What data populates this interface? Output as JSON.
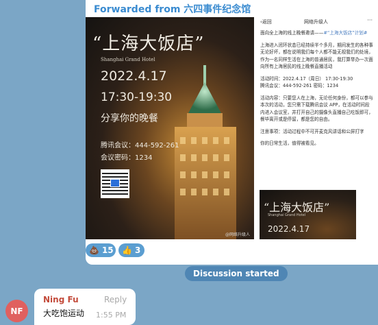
{
  "forward": {
    "label": "Forwarded from 六四事件纪念馆"
  },
  "poster": {
    "title": "“上海大饭店”",
    "subtitle": "Shanghai Grand Hotel",
    "date": "2022.4.17",
    "time": "17:30-19:30",
    "tagline": "分享你的晚餐",
    "meeting": "腾讯会议：444-592-261",
    "password": "会议密码：1234",
    "watermark": "@网络升级人"
  },
  "article": {
    "back": "‹返回",
    "account": "网络升级人",
    "more": "···",
    "intro_prefix": "面向全上海的线上晚餐邀请——",
    "intro_link": "#“上海大饭店”计划#",
    "para1": "上海进入闭环状态已经持续半个多月，期间发生的各种事无论好坏，都在说明我们每个人都不能无视我们的处境，作为一名同样生活在上海的普通居民，我打算举办一次面向所有上海居民的线上晚餐直播活动",
    "time_line": "活动时间：2022.4.17（周日） 17:30-19:30",
    "meeting_line": "腾讯会议：444-592-261   密码：1234",
    "content": "活动内容：只要您人在上海，无论任何身份，都可以参与本次的活动，您只需下载腾讯会议 APP，在活动时间段内进入会议室，并打开自己的摄像头直播自己吃饭即可，餐毕离开或是停留，都是您的自由。",
    "notice": "注意事项：活动过程中不可开麦克风讲话和公屏打字",
    "footer": "你的日常生活，值得被看见。",
    "thumb_title": "“上海大饭店”",
    "thumb_sub": "Shanghai Grand Hotel",
    "thumb_date": "2022.4.17"
  },
  "reactions": [
    {
      "emoji": "💩",
      "count": "15"
    },
    {
      "emoji": "👍",
      "count": "3"
    }
  ],
  "discussion": {
    "label": "Discussion started"
  },
  "comment": {
    "initials": "NF",
    "name": "Ning Fu",
    "reply": "Reply",
    "text": "大吃饱运动",
    "time": "1:55 PM"
  },
  "colors": {
    "background": "#7ba6c6",
    "link": "#3a8bd0",
    "avatar": "#e0605f",
    "reaction": "#5b9ed1"
  }
}
